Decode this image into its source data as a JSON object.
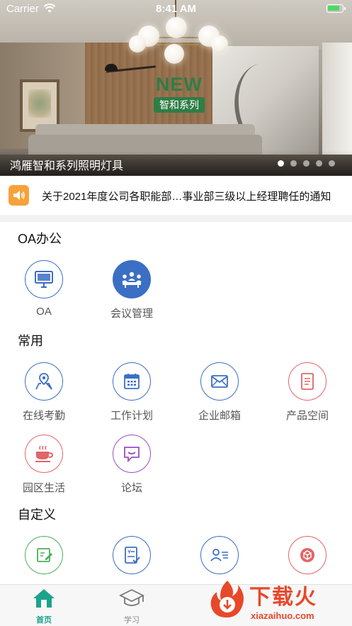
{
  "status_bar": {
    "carrier": "Carrier",
    "time": "8:41 AM"
  },
  "banner": {
    "badge_new": "NEW",
    "badge_series": "智和系列",
    "caption": "鸿雁智和系列照明灯具",
    "slide_count": 5,
    "active_slide": 1
  },
  "notice": {
    "text": "关于2021年度公司各职能部…事业部三级以上经理聘任的通知",
    "icon": "speaker-icon"
  },
  "sections": {
    "oa": {
      "title": "OA办公",
      "items": [
        {
          "label": "OA",
          "icon": "monitor-icon"
        },
        {
          "label": "会议管理",
          "icon": "meeting-icon"
        }
      ]
    },
    "common": {
      "title": "常用",
      "items": [
        {
          "label": "在线考勤",
          "icon": "map-pin-icon"
        },
        {
          "label": "工作计划",
          "icon": "calendar-icon"
        },
        {
          "label": "企业邮箱",
          "icon": "mail-icon"
        },
        {
          "label": "产品空间",
          "icon": "document-icon"
        },
        {
          "label": "园区生活",
          "icon": "coffee-icon"
        },
        {
          "label": "论坛",
          "icon": "chat-icon"
        }
      ]
    },
    "custom": {
      "title": "自定义",
      "items": [
        {
          "icon": "edit-icon"
        },
        {
          "icon": "receipt-icon"
        },
        {
          "icon": "contact-card-icon"
        },
        {
          "icon": "box-icon"
        }
      ]
    }
  },
  "tabbar": {
    "items": [
      {
        "label": "首页",
        "icon": "home-icon",
        "active": true
      },
      {
        "label": "学习",
        "icon": "graduation-cap-icon",
        "active": false
      }
    ]
  },
  "watermark": {
    "title": "下载火",
    "url": "xiazaihuo.com"
  },
  "colors": {
    "primary_blue": "#3b6fc4",
    "red": "#e26567",
    "purple": "#9b4fc4",
    "green": "#4caf58",
    "notice_orange": "#f6a23a",
    "tab_active": "#1aa38d",
    "badge_green": "#2f7d46"
  }
}
